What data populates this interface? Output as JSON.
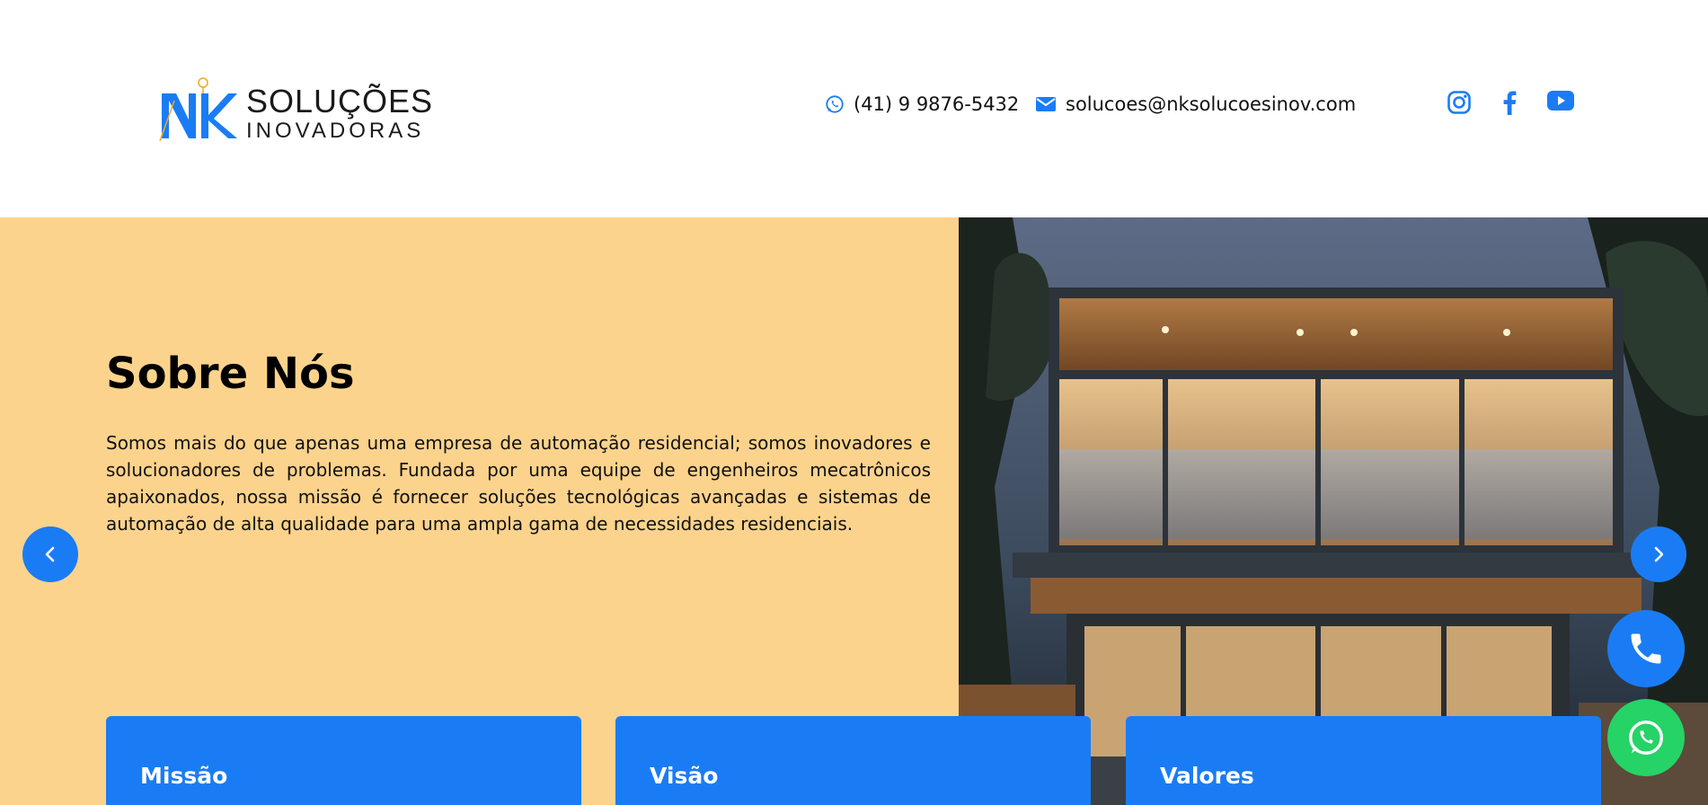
{
  "header": {
    "logo": {
      "line1": "SOLUÇÕES",
      "line2": "INOVADORAS",
      "mark_letters": "NK"
    },
    "phone": {
      "icon": "whatsapp-icon",
      "text": "(41) 9 9876-5432"
    },
    "email": {
      "icon": "envelope-icon",
      "text": "solucoes@nksolucoesinov.com"
    },
    "social": [
      {
        "name": "instagram-icon"
      },
      {
        "name": "facebook-icon"
      },
      {
        "name": "youtube-icon"
      }
    ]
  },
  "hero": {
    "title": "Sobre Nós",
    "text": "Somos mais do que apenas uma empresa de automação residencial; somos inovadores e solucionadores de problemas. Fundada por uma equipe de engenheiros mecatrônicos apaixonados, nossa missão é fornecer soluções tecnológicas avançadas e sistemas de automação de alta qualidade para uma ampla gama de necessidades residenciais.",
    "image": "modern-house-night-photo",
    "cards": [
      {
        "title": "Missão"
      },
      {
        "title": "Visão"
      },
      {
        "title": "Valores"
      }
    ]
  },
  "colors": {
    "accent": "#1a7cf5",
    "hero_bg": "#fcd38c",
    "whatsapp": "#25d366",
    "text": "#111111"
  }
}
